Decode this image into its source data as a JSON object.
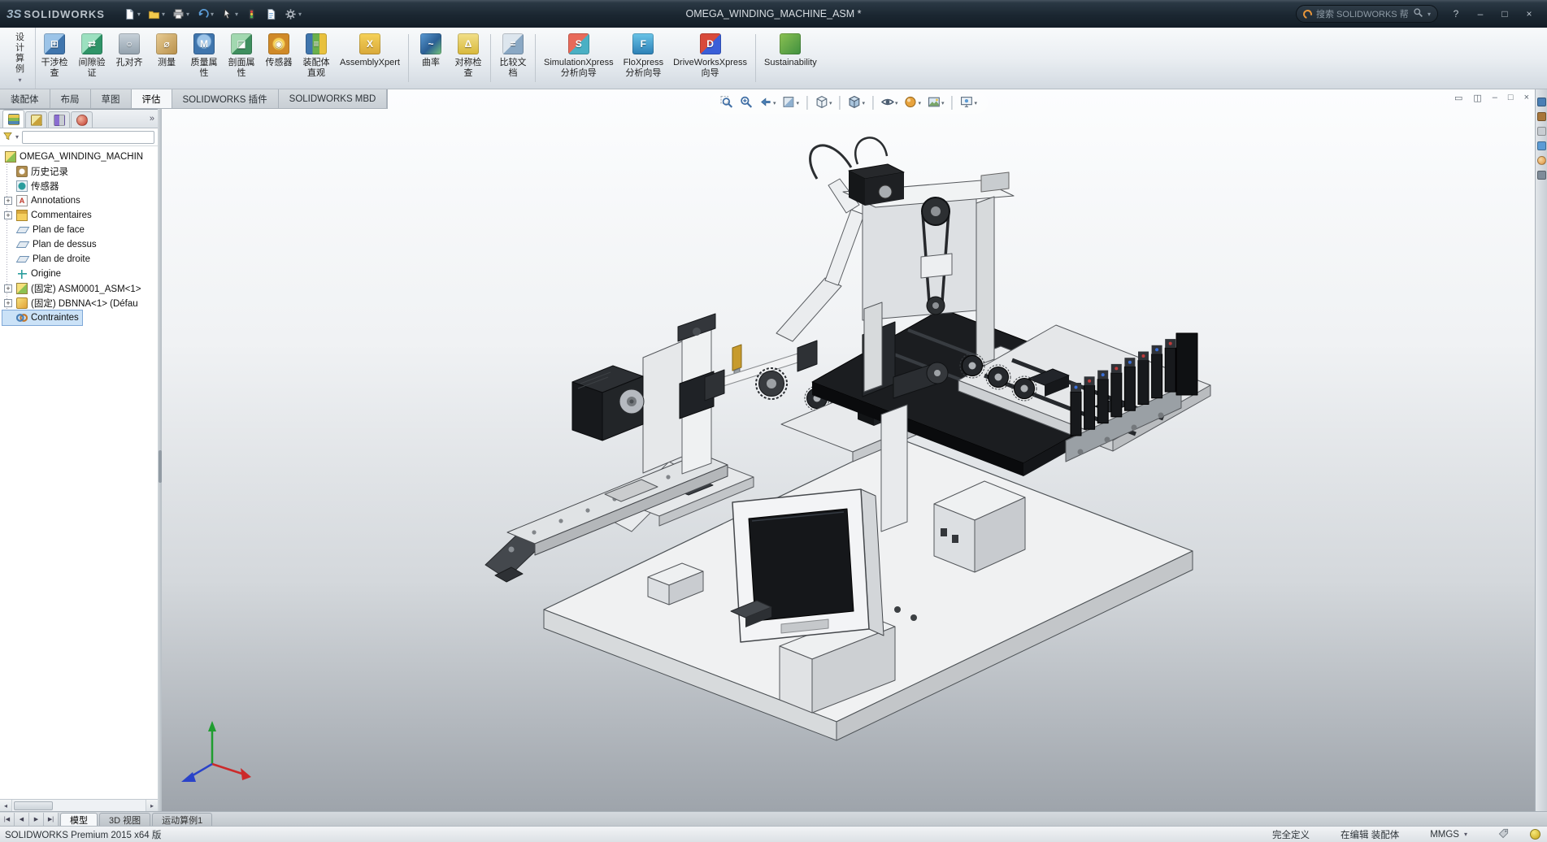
{
  "colors": {
    "titlebar_bg": "#1b2731",
    "accent_blue": "#4a7fb5",
    "selection_blue": "#cbe2f7",
    "viewport_gradient_top": "#fcfdfe",
    "viewport_gradient_bottom": "#9ea4ab"
  },
  "glyphs": {
    "caret": "▾",
    "expand": "+",
    "scroll_left": "◂",
    "scroll_right": "▸"
  },
  "titlebar": {
    "logo_prefix": "3S",
    "logo_text": "SOLIDWORKS",
    "document_title": "OMEGA_WINDING_MACHINE_ASM *",
    "search": {
      "placeholder": "搜索 SOLIDWORKS 帮助"
    },
    "quick_tools": [
      {
        "name": "new-document",
        "icon": "page",
        "caret": true
      },
      {
        "name": "open",
        "icon": "folder",
        "caret": true
      },
      {
        "name": "print",
        "icon": "printer",
        "caret": true
      },
      {
        "name": "undo",
        "icon": "undo",
        "caret": true
      },
      {
        "name": "select",
        "icon": "cursor",
        "caret": true
      },
      {
        "name": "rebuild",
        "icon": "rebuild",
        "caret": false
      },
      {
        "name": "file-properties",
        "icon": "props",
        "caret": false
      },
      {
        "name": "options",
        "icon": "gear",
        "caret": true
      }
    ],
    "window_controls": [
      {
        "name": "help",
        "glyph": "?"
      },
      {
        "name": "minimize",
        "glyph": "–"
      },
      {
        "name": "maximize",
        "glyph": "□"
      },
      {
        "name": "close",
        "glyph": "×"
      }
    ]
  },
  "ribbon": {
    "design_study": {
      "chars": [
        "设",
        "计",
        "算",
        "例"
      ],
      "caret": "▾"
    },
    "items": [
      {
        "name": "interference-check",
        "icon": "interference",
        "glyph": "⊞",
        "lines": [
          "干涉检",
          "查"
        ]
      },
      {
        "name": "clearance-verify",
        "icon": "clearance",
        "glyph": "⇄",
        "lines": [
          "间隙验",
          "证"
        ]
      },
      {
        "name": "hole-alignment",
        "icon": "holes",
        "glyph": "○",
        "lines": [
          "孔对齐"
        ]
      },
      {
        "name": "measure",
        "icon": "measure",
        "glyph": "⌀",
        "lines": [
          "测量"
        ]
      },
      {
        "name": "mass-properties",
        "icon": "mass",
        "glyph": "M",
        "lines": [
          "质量属",
          "性"
        ]
      },
      {
        "name": "section-properties",
        "icon": "sectionprop",
        "glyph": "◪",
        "lines": [
          "剖面属",
          "性"
        ]
      },
      {
        "name": "sensor",
        "icon": "sensor",
        "glyph": "◉",
        "lines": [
          "传感器"
        ]
      },
      {
        "name": "assembly-visualization",
        "icon": "assyvis",
        "glyph": "≡",
        "lines": [
          "装配体",
          "直观"
        ]
      },
      {
        "name": "assembly-xpert",
        "icon": "xpert",
        "glyph": "X",
        "lines": [
          "AssemblyXpert"
        ],
        "sep_after": true
      },
      {
        "name": "curvature",
        "icon": "curvature",
        "glyph": "~",
        "lines": [
          "曲率"
        ]
      },
      {
        "name": "symmetry-check",
        "icon": "symmetry",
        "glyph": "Δ",
        "lines": [
          "对称检",
          "查"
        ],
        "sep_after": true
      },
      {
        "name": "compare-documents",
        "icon": "compare",
        "glyph": "=",
        "lines": [
          "比较文",
          "档"
        ],
        "sep_after": true
      },
      {
        "name": "simulationxpress-wizard",
        "icon": "simulation",
        "glyph": "S",
        "lines": [
          "SimulationXpress",
          "分析向导"
        ]
      },
      {
        "name": "floxpress-wizard",
        "icon": "flo",
        "glyph": "F",
        "lines": [
          "FloXpress",
          "分析向导"
        ]
      },
      {
        "name": "driveworksxpress-wizard",
        "icon": "driveworks",
        "glyph": "D",
        "lines": [
          "DriveWorksXpress",
          "向导"
        ],
        "sep_after": true
      },
      {
        "name": "sustainability",
        "icon": "sustain",
        "glyph": "",
        "lines": [
          "Sustainability"
        ]
      }
    ]
  },
  "command_tabs": {
    "tabs": [
      {
        "name": "assembly",
        "label": "装配体"
      },
      {
        "name": "layout",
        "label": "布局"
      },
      {
        "name": "sketch",
        "label": "草图"
      },
      {
        "name": "evaluate",
        "label": "评估",
        "active": true
      },
      {
        "name": "solidworks-addins",
        "label": "SOLIDWORKS 插件"
      },
      {
        "name": "solidworks-mbd",
        "label": "SOLIDWORKS MBD"
      }
    ]
  },
  "doc_window_controls": [
    {
      "name": "viewport-layout-single",
      "glyph": "▭"
    },
    {
      "name": "viewport-layout-split",
      "glyph": "◫"
    },
    {
      "name": "doc-minimize",
      "glyph": "–"
    },
    {
      "name": "doc-restore",
      "glyph": "□"
    },
    {
      "name": "doc-close",
      "glyph": "×"
    }
  ],
  "hud": {
    "buttons": [
      {
        "name": "zoom-to-fit",
        "icon": "zoomfit",
        "caret": false
      },
      {
        "name": "zoom-to-area",
        "icon": "zoomarea",
        "caret": false
      },
      {
        "name": "previous-view",
        "icon": "prevview",
        "caret": true
      },
      {
        "name": "section-view",
        "icon": "section",
        "caret": true
      },
      {
        "separator": true
      },
      {
        "name": "view-orientation",
        "icon": "cube",
        "caret": true
      },
      {
        "separator": true
      },
      {
        "name": "display-style",
        "icon": "displaystyle",
        "caret": true
      },
      {
        "separator": true
      },
      {
        "name": "hide-show-items",
        "icon": "eye",
        "caret": true
      },
      {
        "name": "edit-appearance",
        "icon": "appearance",
        "caret": true
      },
      {
        "name": "apply-scene",
        "icon": "scene",
        "caret": true
      },
      {
        "separator": true
      },
      {
        "name": "view-settings",
        "icon": "viewsettings",
        "caret": true
      }
    ]
  },
  "feature_panel": {
    "tabs": [
      {
        "name": "featuremanager-tree",
        "active": true
      },
      {
        "name": "propertymanager"
      },
      {
        "name": "configurationmanager"
      },
      {
        "name": "displaymanager"
      }
    ],
    "overflow_glyph": "»",
    "tree": [
      {
        "name": "root-assembly",
        "icon": "assembly",
        "label": "OMEGA_WINDING_MACHIN",
        "root": true
      },
      {
        "name": "history-folder",
        "icon": "history",
        "label": "历史记录"
      },
      {
        "name": "sensors-folder",
        "icon": "sensors",
        "label": "传感器"
      },
      {
        "name": "annotations-folder",
        "icon": "annotations",
        "label": "Annotations",
        "expand": true
      },
      {
        "name": "comments-folder",
        "icon": "folder",
        "label": "Commentaires",
        "expand": true
      },
      {
        "name": "front-plane",
        "icon": "plane",
        "label": "Plan de face"
      },
      {
        "name": "top-plane",
        "icon": "plane",
        "label": "Plan de dessus"
      },
      {
        "name": "right-plane",
        "icon": "plane",
        "label": "Plan de droite"
      },
      {
        "name": "origin",
        "icon": "origin",
        "label": "Origine"
      },
      {
        "name": "component-asm0001",
        "icon": "assembly",
        "label": "(固定) ASM0001_ASM<1>",
        "expand": true
      },
      {
        "name": "component-dbnna",
        "icon": "part",
        "label": "(固定) DBNNA<1> (Défau",
        "expand": true
      },
      {
        "name": "mates-folder",
        "icon": "mates",
        "label": "Contraintes",
        "selected": true
      }
    ]
  },
  "task_pane_tabs": [
    {
      "name": "solidworks-resources"
    },
    {
      "name": "design-library"
    },
    {
      "name": "file-explorer"
    },
    {
      "name": "view-palette"
    },
    {
      "name": "appearances-scenes"
    },
    {
      "name": "custom-properties"
    }
  ],
  "motion_bar": {
    "nav": [
      {
        "name": "jump-to-start",
        "glyph": "|◀"
      },
      {
        "name": "step-back",
        "glyph": "◀"
      },
      {
        "name": "step-forward",
        "glyph": "▶"
      },
      {
        "name": "jump-to-end",
        "glyph": "▶|"
      }
    ],
    "tabs": [
      {
        "name": "model",
        "label": "模型",
        "active": true
      },
      {
        "name": "3d-views",
        "label": "3D 视图"
      },
      {
        "name": "motion-study-1",
        "label": "运动算例1"
      }
    ]
  },
  "statusbar": {
    "left": "SOLIDWORKS Premium 2015 x64 版",
    "define_state": "完全定义",
    "editing": "在编辑 装配体",
    "units": "MMGS"
  }
}
